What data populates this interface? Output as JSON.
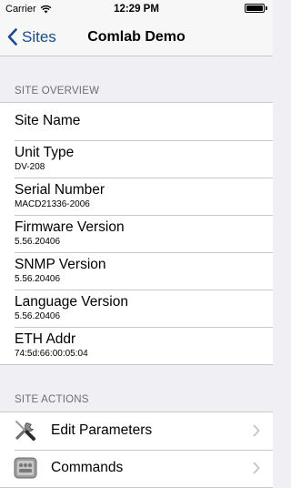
{
  "status_bar": {
    "carrier": "Carrier",
    "time": "12:29 PM",
    "battery_level": 1.0
  },
  "nav": {
    "back_label": "Sites",
    "title": "Comlab Demo"
  },
  "site_overview": {
    "header": "SITE OVERVIEW",
    "rows": [
      {
        "label": "Site Name",
        "value": ""
      },
      {
        "label": "Unit Type",
        "value": "DV-208"
      },
      {
        "label": "Serial Number",
        "value": "MACD21336-2006"
      },
      {
        "label": "Firmware Version",
        "value": "5.56.20406"
      },
      {
        "label": "SNMP Version",
        "value": "5.56.20406"
      },
      {
        "label": "Language Version",
        "value": "5.56.20406"
      },
      {
        "label": "ETH Addr",
        "value": "74:5d:66:00:05:04"
      }
    ]
  },
  "site_actions": {
    "header": "SITE ACTIONS",
    "items": [
      {
        "label": "Edit Parameters",
        "icon": "wrench-screwdriver-icon"
      },
      {
        "label": "Commands",
        "icon": "commands-icon"
      }
    ]
  },
  "colors": {
    "accent": "#1b4b8c",
    "background": "#efeff4",
    "separator": "#c8c7cc"
  }
}
